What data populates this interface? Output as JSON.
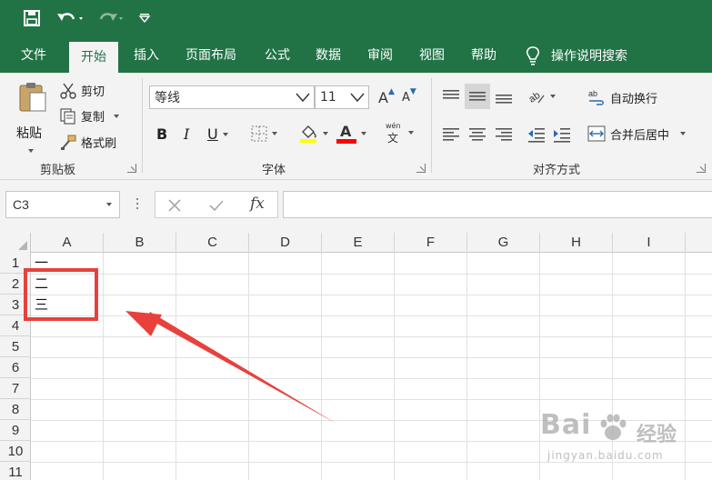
{
  "quick_access": {
    "icons": [
      "save-icon",
      "undo-icon",
      "redo-icon",
      "customize-icon"
    ]
  },
  "menu": {
    "tabs": [
      {
        "label": "文件",
        "active": false
      },
      {
        "label": "开始",
        "active": true
      },
      {
        "label": "插入",
        "active": false
      },
      {
        "label": "页面布局",
        "active": false
      },
      {
        "label": "公式",
        "active": false
      },
      {
        "label": "数据",
        "active": false
      },
      {
        "label": "审阅",
        "active": false
      },
      {
        "label": "视图",
        "active": false
      },
      {
        "label": "帮助",
        "active": false
      }
    ],
    "search_label": "操作说明搜索"
  },
  "ribbon": {
    "clipboard": {
      "paste": "粘贴",
      "cut": "剪切",
      "copy": "复制",
      "format_painter": "格式刷",
      "group_label": "剪贴板"
    },
    "font": {
      "font_name": "等线",
      "font_size": "11",
      "grow": "A",
      "shrink": "A",
      "bold": "B",
      "italic": "I",
      "underline": "U",
      "font_color_letter": "A",
      "phonetic_top": "wén",
      "phonetic_bottom": "文",
      "group_label": "字体",
      "fill_color": "#ffff00",
      "font_color": "#ff0000"
    },
    "alignment": {
      "wrap_text": "自动换行",
      "merge_center": "合并后居中",
      "group_label": "对齐方式"
    }
  },
  "formula_bar": {
    "name_box": "C3",
    "fx": "fx",
    "formula": ""
  },
  "sheet": {
    "columns": [
      "A",
      "B",
      "C",
      "D",
      "E",
      "F",
      "G",
      "H",
      "I"
    ],
    "rows": [
      "1",
      "2",
      "3",
      "4",
      "5",
      "6",
      "7",
      "8",
      "9",
      "10",
      "11"
    ],
    "cells": [
      {
        "ref": "A1",
        "value": "一"
      },
      {
        "ref": "A2",
        "value": "二"
      },
      {
        "ref": "A3",
        "value": "三"
      }
    ]
  },
  "annotation": {
    "color": "#e8413c"
  },
  "watermark": {
    "main": "Bai",
    "cn": "经验",
    "sub": "jingyan.baidu.com"
  }
}
